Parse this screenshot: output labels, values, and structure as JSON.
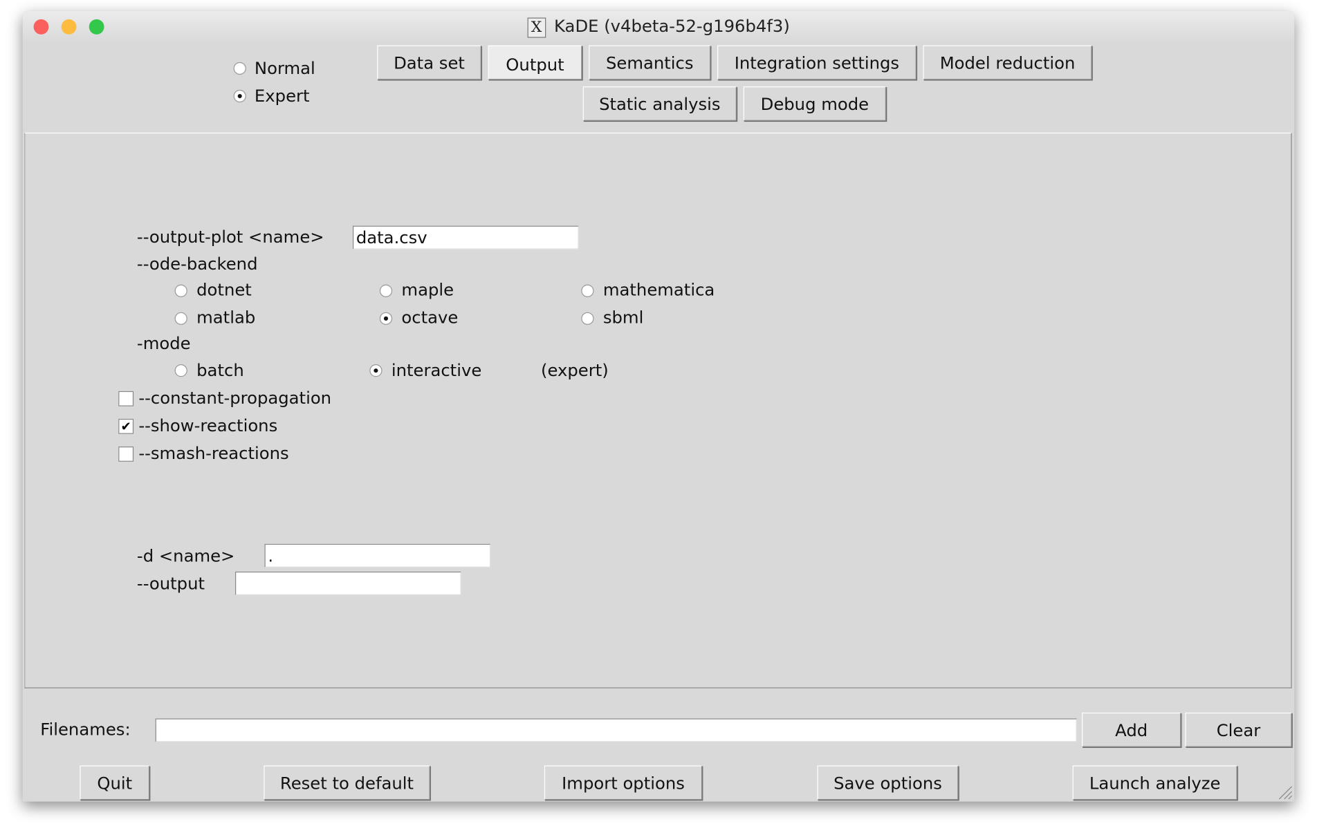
{
  "window": {
    "title": "KaDE (v4beta-52-g196b4f3)"
  },
  "mode_select": {
    "options": [
      "Normal",
      "Expert"
    ],
    "selected": "Expert"
  },
  "tabs": [
    {
      "label": "Data set",
      "selected": false
    },
    {
      "label": "Output",
      "selected": true
    },
    {
      "label": "Semantics",
      "selected": false
    },
    {
      "label": "Integration settings",
      "selected": false
    },
    {
      "label": "Model reduction",
      "selected": false
    },
    {
      "label": "Static analysis",
      "selected": false
    },
    {
      "label": "Debug mode",
      "selected": false
    }
  ],
  "output": {
    "output_plot": {
      "label": "--output-plot <name>",
      "value": "data.csv"
    },
    "ode_backend": {
      "label": "--ode-backend",
      "options": [
        "dotnet",
        "maple",
        "mathematica",
        "matlab",
        "octave",
        "sbml"
      ],
      "selected": "octave"
    },
    "mode": {
      "label": "-mode",
      "options": [
        "batch",
        "interactive"
      ],
      "selected": "interactive",
      "note": "(expert)"
    },
    "constant_propagation": {
      "label": "--constant-propagation",
      "checked": false
    },
    "show_reactions": {
      "label": "--show-reactions",
      "checked": true
    },
    "smash_reactions": {
      "label": "--smash-reactions",
      "checked": false
    },
    "d_name": {
      "label": "-d <name>",
      "value": "."
    },
    "output_field": {
      "label": "--output",
      "value": ""
    }
  },
  "filenames": {
    "label": "Filenames:",
    "value": "",
    "add": "Add",
    "clear": "Clear"
  },
  "footer": {
    "quit": "Quit",
    "reset": "Reset to default",
    "import": "Import options",
    "save": "Save options",
    "launch": "Launch analyze"
  }
}
